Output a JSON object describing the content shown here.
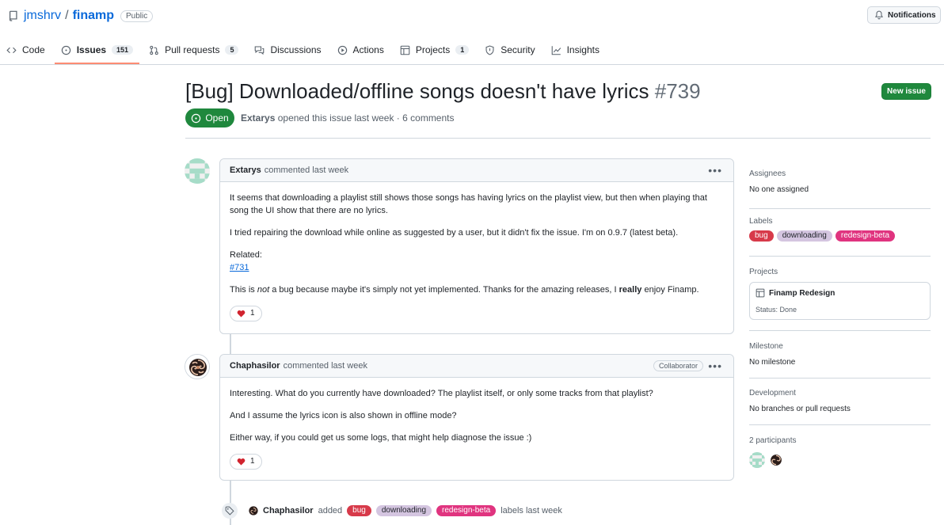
{
  "repo": {
    "owner": "jmshrv",
    "separator": "/",
    "name": "finamp",
    "visibility": "Public"
  },
  "header": {
    "notifications_label": "Notifications"
  },
  "tabs": [
    {
      "label": "Code",
      "icon": "code-icon"
    },
    {
      "label": "Issues",
      "icon": "issue-icon",
      "count": "151",
      "selected": true
    },
    {
      "label": "Pull requests",
      "icon": "pull-request-icon",
      "count": "5"
    },
    {
      "label": "Discussions",
      "icon": "discussions-icon"
    },
    {
      "label": "Actions",
      "icon": "play-icon"
    },
    {
      "label": "Projects",
      "icon": "table-icon",
      "count": "1"
    },
    {
      "label": "Security",
      "icon": "shield-icon"
    },
    {
      "label": "Insights",
      "icon": "graph-icon"
    }
  ],
  "issue": {
    "title": "[Bug] Downloaded/offline songs doesn't have lyrics",
    "number": "#739",
    "state": "Open",
    "author": "Extarys",
    "opened_text": "opened this issue last week · 6 comments",
    "new_issue_label": "New issue"
  },
  "comments": [
    {
      "author": "Extarys",
      "meta": "commented last week",
      "p1": "It seems that downloading a playlist still shows those songs has having lyrics on the playlist view, but then when playing that song the UI show that there are no lyrics.",
      "p2": "I tried repairing the download while online as suggested by a user, but it didn't fix the issue. I'm on 0.9.7 (latest beta).",
      "related_label": "Related:",
      "related_link": "#731",
      "p4_a": "This is ",
      "p4_em": "not",
      "p4_b": " a bug because maybe it's simply not yet implemented. Thanks for the amazing releases, I ",
      "p4_strong": "really",
      "p4_c": " enjoy Finamp.",
      "reaction_count": "1"
    },
    {
      "author": "Chaphasilor",
      "meta": "commented last week",
      "badge": "Collaborator",
      "p1": "Interesting. What do you currently have downloaded? The playlist itself, or only some tracks from that playlist?",
      "p2": "And I assume the lyrics icon is also shown in offline mode?",
      "p3": "Either way, if you could get us some logs, that might help diagnose the issue :)",
      "reaction_count": "1"
    }
  ],
  "event": {
    "actor": "Chaphasilor",
    "verb": "added",
    "labels": [
      "bug",
      "downloading",
      "redesign-beta"
    ],
    "suffix": "labels last week"
  },
  "sidebar": {
    "assignees": {
      "heading": "Assignees",
      "value": "No one assigned"
    },
    "labels": {
      "heading": "Labels",
      "items": [
        "bug",
        "downloading",
        "redesign-beta"
      ]
    },
    "projects": {
      "heading": "Projects",
      "name": "Finamp Redesign",
      "status": "Status: Done"
    },
    "milestone": {
      "heading": "Milestone",
      "value": "No milestone"
    },
    "development": {
      "heading": "Development",
      "value": "No branches or pull requests"
    },
    "participants": {
      "heading": "2 participants"
    }
  },
  "colors": {
    "accent_blue": "#0969da",
    "open_green": "#1f883d",
    "label_bug": "#d73a4a",
    "label_downloading": "#d4c5e0",
    "label_redesign_beta": "#e0347f",
    "tab_underline": "#fd8c73"
  }
}
